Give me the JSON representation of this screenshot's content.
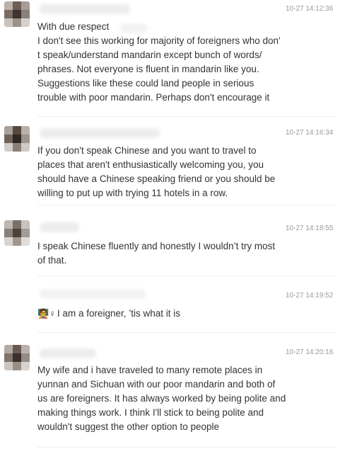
{
  "comments": [
    {
      "time": "10-27 14:12:36",
      "lines": [
        "With due respect",
        "I don't see this working for majority of foreigners who don'",
        "t speak/understand mandarin except bunch of words/",
        "phrases. Not everyone is fluent in mandarin like you.",
        "Suggestions like these could land people in serious",
        "trouble with poor mandarin. Perhaps don't encourage it"
      ]
    },
    {
      "time": "10-27 14:16:34",
      "lines": [
        "If you don't speak Chinese and you want to travel to",
        "places that aren't enthusiastically welcoming you, you",
        "should have a Chinese speaking friend or you should be",
        "willing to put up with trying 11 hotels in a row."
      ]
    },
    {
      "time": "10-27 14:18:55",
      "lines": [
        "I speak Chinese fluently and honestly I wouldn’t try most",
        "of that."
      ]
    },
    {
      "time": "10-27 14:19:52",
      "emoji": "🧑‍🏫♀",
      "lines": [
        "I am a foreigner,  ’tis what it is"
      ]
    },
    {
      "time": "10-27 14:20:16",
      "lines": [
        "My wife and  i have traveled to many remote places in",
        "yunnan and Sichuan with our poor mandarin and both of",
        "us are foreigners. It has always worked by being polite and",
        "making things work. I think I'll stick to being polite and",
        "wouldn't suggest the other option to people"
      ]
    }
  ]
}
